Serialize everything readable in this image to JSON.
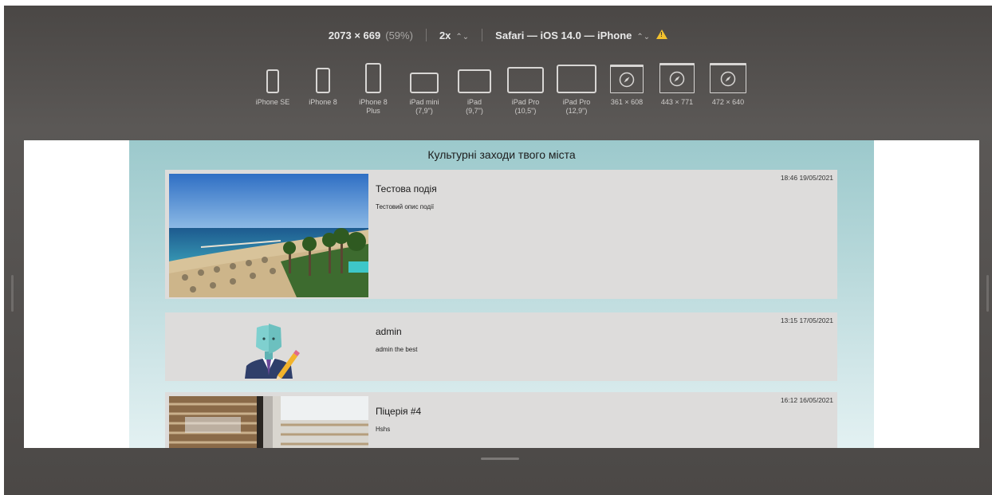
{
  "toolbar": {
    "dimensions": "2073 × 669",
    "zoom": "(59%)",
    "scale": "2x",
    "browser": "Safari — iOS 14.0 — iPhone",
    "warning_icon": "warning-triangle-icon"
  },
  "devices": [
    {
      "label": "iPhone SE",
      "icon": "phone-icon"
    },
    {
      "label": "iPhone 8",
      "icon": "phone-icon"
    },
    {
      "label": "iPhone 8\nPlus",
      "icon": "phone-icon"
    },
    {
      "label": "iPad mini\n(7,9\")",
      "icon": "tablet-icon"
    },
    {
      "label": "iPad\n(9,7\")",
      "icon": "tablet-icon"
    },
    {
      "label": "iPad Pro\n(10,5\")",
      "icon": "tablet-icon"
    },
    {
      "label": "iPad Pro\n(12,9\")",
      "icon": "tablet-icon"
    },
    {
      "label": "361 × 608",
      "icon": "safari-compass-icon"
    },
    {
      "label": "443 × 771",
      "icon": "safari-compass-icon"
    },
    {
      "label": "472 × 640",
      "icon": "safari-compass-icon"
    }
  ],
  "site": {
    "title": "Культурні заходи твого міста",
    "events": [
      {
        "name": "Тестова подія",
        "description": "Тестовий опис події",
        "time": "18:46 19/05/2021",
        "image": "beach-resort-photo"
      },
      {
        "name": "admin",
        "description": "admin the best",
        "time": "13:15 17/05/2021",
        "image": "admin-avatar-icon"
      },
      {
        "name": "Піцерія #4",
        "description": "Hshs",
        "time": "16:12 16/05/2021",
        "image": "window-blinds-photo"
      }
    ]
  }
}
